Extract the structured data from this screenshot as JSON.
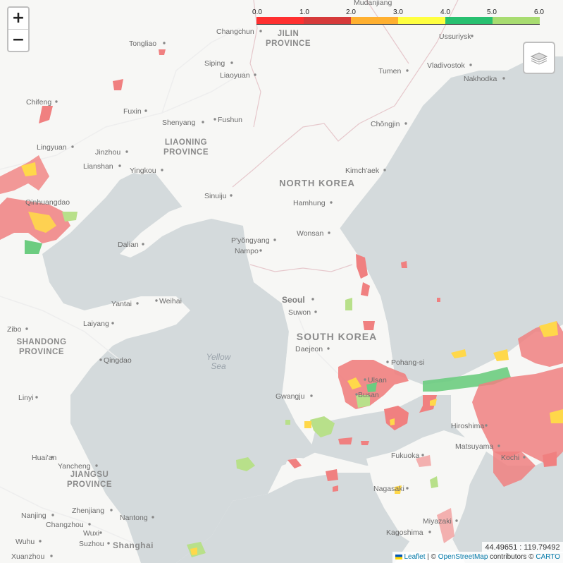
{
  "legend": {
    "ticks": [
      "0.0",
      "1.0",
      "2.0",
      "3.0",
      "4.0",
      "5.0",
      "6.0"
    ],
    "colors": [
      "#ff3030",
      "#d63a3a",
      "#ffb030",
      "#ffff40",
      "#28c070",
      "#a8dc70"
    ]
  },
  "zoom": {
    "in": "+",
    "out": "−"
  },
  "cities": [
    "Mudanjiang",
    "Changchun",
    "Ussuriysk",
    "Tongliao",
    "Siping",
    "Liaoyuan",
    "Tumen",
    "Vladivostok",
    "Nakhodka",
    "Chifeng",
    "Fuxin",
    "Shenyang",
    "Fushun",
    "Chŏngjin",
    "Lingyuan",
    "Jinzhou",
    "Lianshan",
    "Yingkou",
    "Kimch'aek",
    "Qinhuangdao",
    "Sinuiju",
    "Hamhung",
    "Dalian",
    "P'yŏngyang",
    "Nampo",
    "Wonsan",
    "Yantai",
    "Weihai",
    "Seoul",
    "Suwon",
    "Laiyang",
    "Zibo",
    "Daejeon",
    "Qingdao",
    "Pohang-si",
    "Ulsan",
    "Linyi",
    "Busan",
    "Gwangju",
    "Hiroshima",
    "Matsuyama",
    "Fukuoka",
    "Kochi",
    "Huai'an",
    "Yancheng",
    "Nagasaki",
    "Zhenjiang",
    "Nantong",
    "Nanjing",
    "Changzhou",
    "Miyazaki",
    "Wuxi",
    "Wuhu",
    "Suzhou",
    "Kagoshima",
    "Xuanzhou",
    "Shanghai"
  ],
  "provinces": [
    "JILIN PROVINCE",
    "LIAONING PROVINCE",
    "SHANDONG PROVINCE",
    "JIANGSU PROVINCE"
  ],
  "countries": [
    "NORTH KOREA",
    "SOUTH KOREA"
  ],
  "seas": [
    "Yellow",
    "Sea"
  ],
  "coords": "44.49651 : 119.79492",
  "attribution": {
    "leaflet": "Leaflet",
    "sep": " | © ",
    "osm": "OpenStreetMap",
    "contrib": " contributors © ",
    "carto": "CARTO"
  }
}
